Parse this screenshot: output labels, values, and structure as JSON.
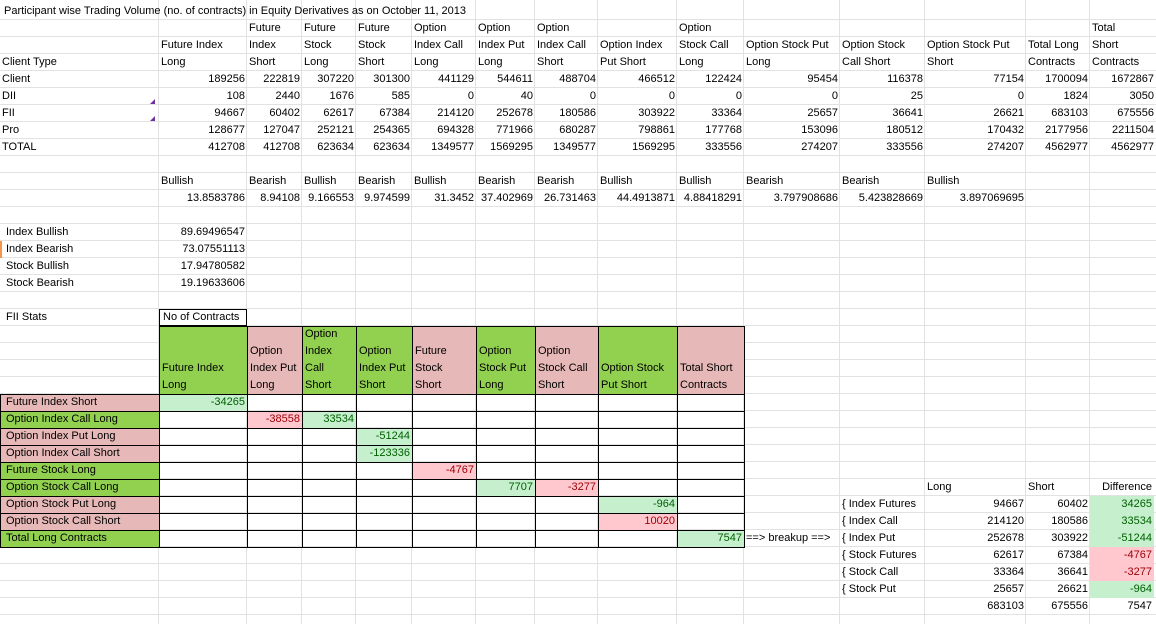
{
  "title": "Participant wise Trading Volume (no. of contracts) in Equity Derivatives as on October 11, 2013",
  "main_table": {
    "headers": [
      [
        "",
        "",
        "",
        "Client Type"
      ],
      [
        "",
        "",
        "Future Index",
        "Long"
      ],
      [
        "",
        "Future",
        "Index",
        "Short"
      ],
      [
        "",
        "Future",
        "Stock",
        "Long"
      ],
      [
        "",
        "Future",
        "Stock",
        "Short"
      ],
      [
        "",
        "Option",
        "Index Call",
        "Long"
      ],
      [
        "",
        "Option",
        "Index Put",
        "Long"
      ],
      [
        "",
        "Option",
        "Index Call",
        "Short"
      ],
      [
        "",
        "",
        "Option Index",
        "Put Short"
      ],
      [
        "",
        "Option",
        "Stock Call",
        "Long"
      ],
      [
        "",
        "",
        "Option Stock Put",
        "Long"
      ],
      [
        "",
        "",
        "Option Stock",
        "Call Short"
      ],
      [
        "",
        "",
        "Option Stock Put",
        "Short"
      ],
      [
        "",
        "",
        "Total Long",
        "Contracts"
      ],
      [
        "",
        "Total",
        "Short",
        "Contracts"
      ]
    ],
    "rows": [
      [
        "Client",
        "189256",
        "222819",
        "307220",
        "301300",
        "441129",
        "544611",
        "488704",
        "466512",
        "122424",
        "95454",
        "116378",
        "77154",
        "1700094",
        "1672867"
      ],
      [
        "DII",
        "108",
        "2440",
        "1676",
        "585",
        "0",
        "40",
        "0",
        "0",
        "0",
        "0",
        "25",
        "0",
        "1824",
        "3050"
      ],
      [
        "FII",
        "94667",
        "60402",
        "62617",
        "67384",
        "214120",
        "252678",
        "180586",
        "303922",
        "33364",
        "25657",
        "36641",
        "26621",
        "683103",
        "675556"
      ],
      [
        "Pro",
        "128677",
        "127047",
        "252121",
        "254365",
        "694328",
        "771966",
        "680287",
        "798861",
        "177768",
        "153096",
        "180512",
        "170432",
        "2177956",
        "2211504"
      ],
      [
        "TOTAL",
        "412708",
        "412708",
        "623634",
        "623634",
        "1349577",
        "1569295",
        "1349577",
        "1569295",
        "333556",
        "274207",
        "333556",
        "274207",
        "4562977",
        "4562977"
      ]
    ]
  },
  "sentiment": {
    "labels": [
      "Bullish",
      "Bearish",
      "Bullish",
      "Bearish",
      "Bullish",
      "Bearish",
      "Bearish",
      "Bullish",
      "Bullish",
      "Bearish",
      "Bearish",
      "Bullish"
    ],
    "values": [
      "13.8583786",
      "8.94108",
      "9.166553",
      "9.974599",
      "31.3452",
      "37.402969",
      "26.731463",
      "44.4913871",
      "4.88418291",
      "3.797908686",
      "5.423828669",
      "3.897069695"
    ]
  },
  "summary": [
    {
      "label": "Index Bullish",
      "value": "89.69496547"
    },
    {
      "label": "Index Bearish",
      "value": "73.07551113"
    },
    {
      "label": "Stock Bullish",
      "value": "17.94780582"
    },
    {
      "label": "Stock Bearish",
      "value": "19.19633606"
    }
  ],
  "fii": {
    "title": "FII Stats",
    "box_title": "No of Contracts",
    "col_headers": [
      [
        "",
        "",
        "Future Index",
        "Long"
      ],
      [
        "",
        "Option",
        "Index Put",
        "Long"
      ],
      [
        "Option",
        "Index",
        "Call",
        "Short"
      ],
      [
        "",
        "Option",
        "Index Put",
        "Short"
      ],
      [
        "",
        "Future",
        "Stock",
        "Short"
      ],
      [
        "",
        "Option",
        "Stock Put",
        "Long"
      ],
      [
        "",
        "Option",
        "Stock Call",
        "Short"
      ],
      [
        "",
        "",
        "Option Stock",
        "Put Short"
      ],
      [
        "",
        "",
        "Total Short",
        "Contracts"
      ]
    ],
    "row_labels": [
      "Future Index Short",
      "Option Index Call Long",
      "Option Index Put Long",
      "Option Index Call Short",
      "Future Stock Long",
      "Option Stock Call Long",
      "Option Stock Put Long",
      "Option Stock Call Short",
      "Total Long Contracts"
    ],
    "cells": {
      "fis_fil": "-34265",
      "oicl_oipl": "-38558",
      "oicl_oics": "33534",
      "oipl_oips": "-51244",
      "oics_oips": "-123336",
      "fsl_fss": "-4767",
      "oscl_ospl": "7707",
      "oscl_oscs": "-3277",
      "ospl_osps": "-964",
      "oscs_osps": "10020",
      "tlc_tsc": "7547"
    },
    "breakup_label": "==> breakup ==>"
  },
  "breakup": {
    "headers": {
      "long": "Long",
      "short": "Short",
      "diff": "Difference"
    },
    "rows": [
      {
        "label": "{ Index Futures",
        "long": "94667",
        "short": "60402",
        "diff": "34265",
        "positive": true
      },
      {
        "label": "{ Index Call",
        "long": "214120",
        "short": "180586",
        "diff": "33534",
        "positive": true
      },
      {
        "label": "{ Index Put",
        "long": "252678",
        "short": "303922",
        "diff": "-51244",
        "positive": true
      },
      {
        "label": "{ Stock Futures",
        "long": "62617",
        "short": "67384",
        "diff": "-4767",
        "positive": false
      },
      {
        "label": "{ Stock Call",
        "long": "33364",
        "short": "36641",
        "diff": "-3277",
        "positive": false
      },
      {
        "label": "{ Stock Put",
        "long": "25657",
        "short": "26621",
        "diff": "-964",
        "positive": true
      }
    ],
    "totals": {
      "long": "683103",
      "short": "675556",
      "diff": "7547"
    }
  },
  "colors": {
    "green": "#92d050",
    "pink": "#e6b8b7",
    "pos_fill": "#c6efce",
    "neg_fill": "#ffc7ce"
  }
}
